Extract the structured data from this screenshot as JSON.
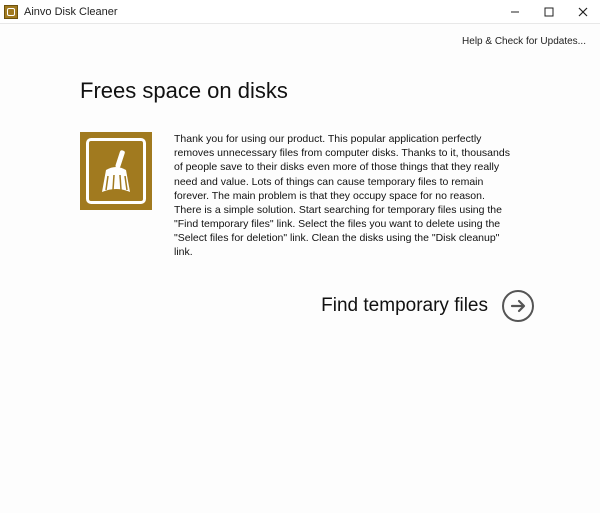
{
  "window": {
    "title": "Ainvo Disk Cleaner"
  },
  "header": {
    "updates_link": "Help & Check for Updates..."
  },
  "main": {
    "page_title": "Frees space on disks",
    "description": "Thank you for using our product. This popular application perfectly removes unnecessary files from computer disks. Thanks to it, thousands of people save to their disks even more of those things that they really need and value. Lots of things can cause temporary files to remain forever. The main problem is that they occupy space for no reason. There is a simple solution. Start searching for temporary files using the \"Find temporary files\" link. Select the files you want to delete using the \"Select files for deletion\" link. Clean the disks using the \"Disk cleanup\" link.",
    "action_label": "Find temporary files"
  },
  "colors": {
    "accent": "#a17a1f"
  }
}
